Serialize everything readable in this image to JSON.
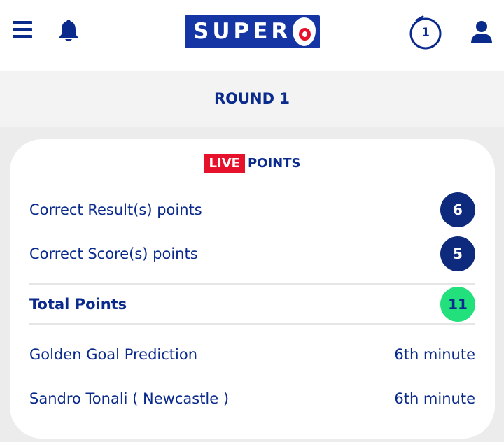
{
  "header": {
    "logo_text": "SUPER",
    "logo_six": "6",
    "round_badge": "1"
  },
  "round": {
    "title": "ROUND 1"
  },
  "card": {
    "live_label": "LIVE",
    "points_label": "POINTS",
    "rows": [
      {
        "label": "Correct Result(s) points",
        "value": "6"
      },
      {
        "label": "Correct Score(s) points",
        "value": "5"
      }
    ],
    "total": {
      "label": "Total Points",
      "value": "11"
    },
    "golden_goal": {
      "label": "Golden Goal Prediction",
      "value": "6th minute"
    },
    "scorer": {
      "label": "Sandro Tonali ( Newcastle )",
      "value": "6th minute"
    }
  },
  "colors": {
    "brand_navy": "#0a2a8c",
    "logo_blue": "#1535a5",
    "live_red": "#e6112b",
    "total_green": "#22e07c"
  },
  "icons": {
    "menu": "menu-icon",
    "notifications": "bell-icon",
    "round": "round-circle-icon",
    "account": "user-icon"
  }
}
